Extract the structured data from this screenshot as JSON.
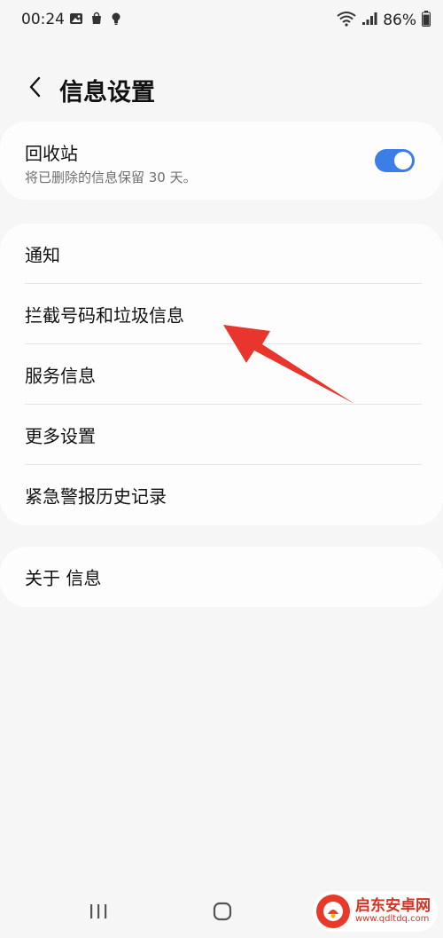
{
  "status_bar": {
    "time": "00:24",
    "battery": "86%"
  },
  "header": {
    "title": "信息设置"
  },
  "recycle_bin": {
    "title": "回收站",
    "subtitle": "将已删除的信息保留 30 天。",
    "enabled": true
  },
  "menu": {
    "items": [
      {
        "label": "通知"
      },
      {
        "label": "拦截号码和垃圾信息"
      },
      {
        "label": "服务信息"
      },
      {
        "label": "更多设置"
      },
      {
        "label": "紧急警报历史记录"
      }
    ]
  },
  "about": {
    "label": "关于 信息"
  },
  "watermark": {
    "name": "启东安卓网",
    "url": "www.qdltdq.com"
  },
  "colors": {
    "accent": "#3b7fe6",
    "annotation": "#e8362e"
  }
}
